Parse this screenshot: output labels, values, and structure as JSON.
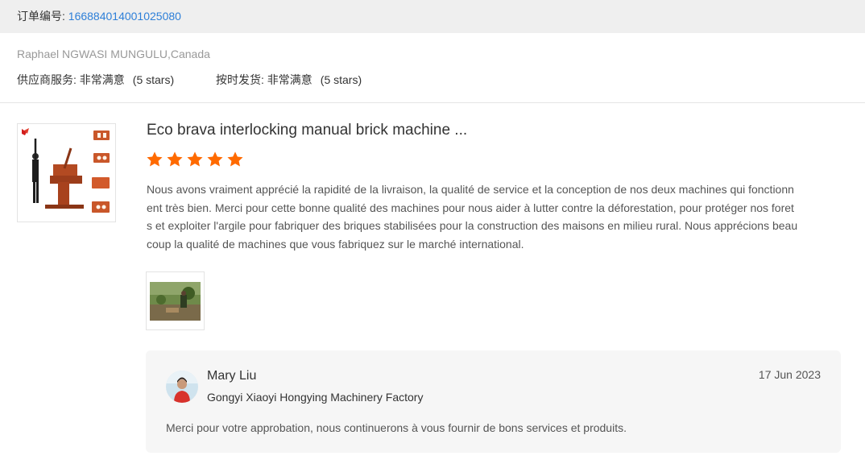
{
  "order": {
    "label": "订单编号: ",
    "number": "166884014001025080"
  },
  "buyer": {
    "name_country": "Raphael NGWASI MUNGULU,Canada"
  },
  "ratings": {
    "supplier_service_label": "供应商服务: ",
    "supplier_service_value": "非常满意",
    "supplier_service_stars": "(5 stars)",
    "on_time_label": "按时发货: ",
    "on_time_value": "非常满意",
    "on_time_stars": "(5 stars)"
  },
  "review": {
    "product_title": "Eco brava interlocking manual brick machine ...",
    "star_rating": 5,
    "star_color": "#ff6a00",
    "text": "Nous avons vraiment apprécié la rapidité de la livraison, la qualité de service et la conception de nos deux machines qui fonctionnent très bien. Merci pour cette bonne qualité des machines pour nous aider à lutter contre la déforestation, pour protéger nos forets et exploiter l'argile pour fabriquer des briques stabilisées pour la construction des maisons en milieu rural. Nous apprécions beaucoup la qualité de machines que vous fabriquez sur le marché international."
  },
  "reply": {
    "name": "Mary Liu",
    "company": "Gongyi Xiaoyi Hongying Machinery Factory",
    "date": "17 Jun 2023",
    "text": "Merci pour votre approbation, nous continuerons à vous fournir de bons services et produits."
  },
  "colors": {
    "link": "#2d7fd8",
    "header_bg": "#efefef",
    "reply_bg": "#f6f6f6"
  }
}
